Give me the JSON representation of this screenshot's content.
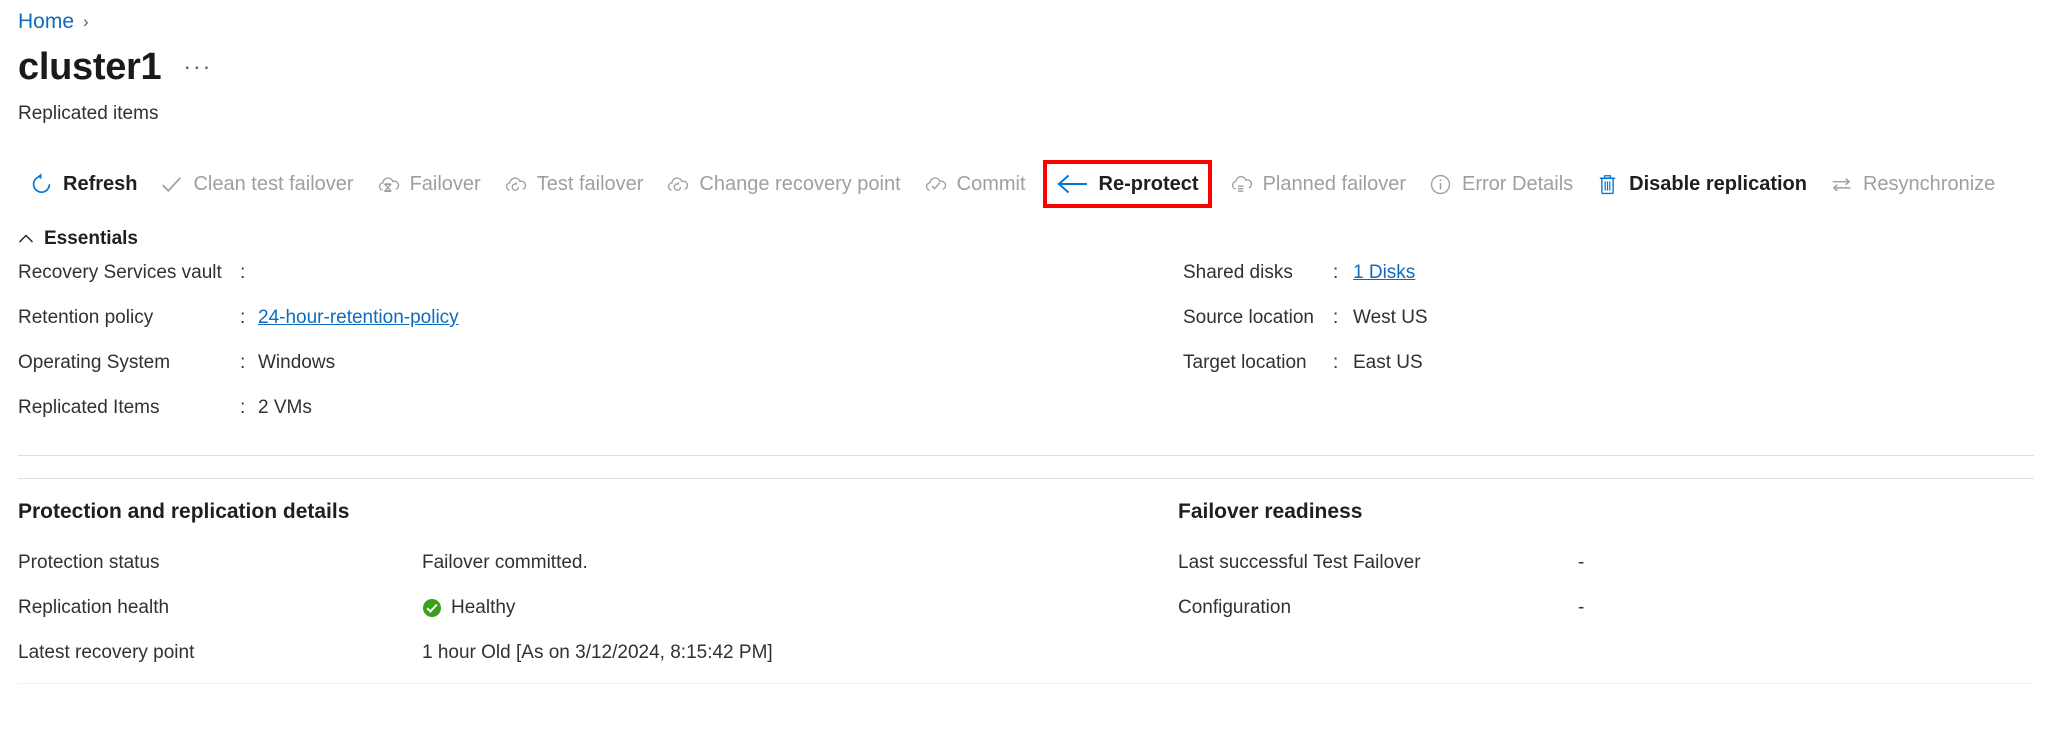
{
  "breadcrumb": {
    "home": "Home",
    "separator": "›"
  },
  "header": {
    "title": "cluster1",
    "ellipsis": "···",
    "subtitle": "Replicated items"
  },
  "commandbar": {
    "items": [
      {
        "label": "Refresh",
        "icon": "refresh-icon",
        "enabled": true,
        "highlighted": false
      },
      {
        "label": "Clean test failover",
        "icon": "checkmark-icon",
        "enabled": false,
        "highlighted": false
      },
      {
        "label": "Failover",
        "icon": "cloud-hourglass-icon",
        "enabled": false,
        "highlighted": false
      },
      {
        "label": "Test failover",
        "icon": "cloud-refresh-icon",
        "enabled": false,
        "highlighted": false
      },
      {
        "label": "Change recovery point",
        "icon": "cloud-refresh-icon",
        "enabled": false,
        "highlighted": false
      },
      {
        "label": "Commit",
        "icon": "cloud-check-icon",
        "enabled": false,
        "highlighted": false
      },
      {
        "label": "Re-protect",
        "icon": "arrow-left-icon",
        "enabled": true,
        "highlighted": true
      },
      {
        "label": "Planned failover",
        "icon": "cloud-list-icon",
        "enabled": false,
        "highlighted": false
      },
      {
        "label": "Error Details",
        "icon": "info-circle-icon",
        "enabled": false,
        "highlighted": false
      },
      {
        "label": "Disable replication",
        "icon": "trash-icon",
        "enabled": true,
        "highlighted": false
      },
      {
        "label": "Resynchronize",
        "icon": "resynchronize-icon",
        "enabled": false,
        "highlighted": false
      }
    ]
  },
  "essentials": {
    "heading": "Essentials",
    "colon": ":",
    "left": [
      {
        "key": "Recovery Services vault",
        "value": "",
        "link": false
      },
      {
        "key": "Retention policy",
        "value": "24-hour-retention-policy",
        "link": true
      },
      {
        "key": "Operating System",
        "value": "Windows",
        "link": false
      },
      {
        "key": "Replicated Items",
        "value": "2 VMs",
        "link": false
      }
    ],
    "right": [
      {
        "key": "Shared disks",
        "value": "1 Disks",
        "link": true
      },
      {
        "key": "Source location",
        "value": "West US",
        "link": false
      },
      {
        "key": "Target location",
        "value": "East US",
        "link": false
      }
    ]
  },
  "protection": {
    "title": "Protection and replication details",
    "rows": [
      {
        "key": "Protection status",
        "value": "Failover committed.",
        "icon": ""
      },
      {
        "key": "Replication health",
        "value": "Healthy",
        "icon": "healthy-check-icon"
      },
      {
        "key": "Latest recovery point",
        "value": "1 hour Old [As on 3/12/2024, 8:15:42 PM]",
        "icon": ""
      }
    ]
  },
  "failover_readiness": {
    "title": "Failover readiness",
    "rows": [
      {
        "key": "Last successful Test Failover",
        "value": "-"
      },
      {
        "key": "Configuration",
        "value": "-"
      }
    ]
  },
  "colors": {
    "link": "#0f6cbd",
    "accent_blue": "#0078d4",
    "disabled": "#a19f9d",
    "text": "#201f1e",
    "highlight_red": "#ff0000",
    "healthy_green": "#3aa017",
    "divider": "#e1dfdd"
  }
}
